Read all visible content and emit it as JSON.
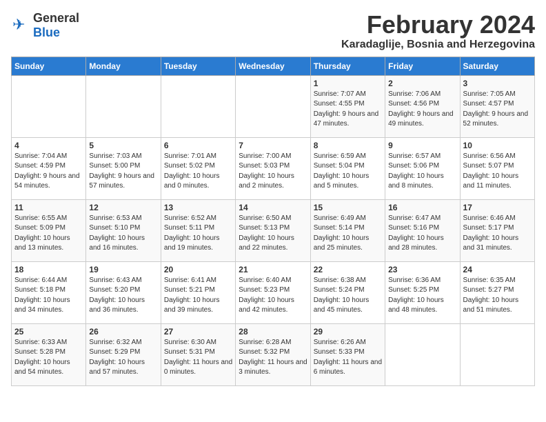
{
  "logo": {
    "general": "General",
    "blue": "Blue"
  },
  "title": "February 2024",
  "location": "Karadaglije, Bosnia and Herzegovina",
  "days_of_week": [
    "Sunday",
    "Monday",
    "Tuesday",
    "Wednesday",
    "Thursday",
    "Friday",
    "Saturday"
  ],
  "weeks": [
    [
      {
        "day": "",
        "info": ""
      },
      {
        "day": "",
        "info": ""
      },
      {
        "day": "",
        "info": ""
      },
      {
        "day": "",
        "info": ""
      },
      {
        "day": "1",
        "info": "Sunrise: 7:07 AM\nSunset: 4:55 PM\nDaylight: 9 hours and 47 minutes."
      },
      {
        "day": "2",
        "info": "Sunrise: 7:06 AM\nSunset: 4:56 PM\nDaylight: 9 hours and 49 minutes."
      },
      {
        "day": "3",
        "info": "Sunrise: 7:05 AM\nSunset: 4:57 PM\nDaylight: 9 hours and 52 minutes."
      }
    ],
    [
      {
        "day": "4",
        "info": "Sunrise: 7:04 AM\nSunset: 4:59 PM\nDaylight: 9 hours and 54 minutes."
      },
      {
        "day": "5",
        "info": "Sunrise: 7:03 AM\nSunset: 5:00 PM\nDaylight: 9 hours and 57 minutes."
      },
      {
        "day": "6",
        "info": "Sunrise: 7:01 AM\nSunset: 5:02 PM\nDaylight: 10 hours and 0 minutes."
      },
      {
        "day": "7",
        "info": "Sunrise: 7:00 AM\nSunset: 5:03 PM\nDaylight: 10 hours and 2 minutes."
      },
      {
        "day": "8",
        "info": "Sunrise: 6:59 AM\nSunset: 5:04 PM\nDaylight: 10 hours and 5 minutes."
      },
      {
        "day": "9",
        "info": "Sunrise: 6:57 AM\nSunset: 5:06 PM\nDaylight: 10 hours and 8 minutes."
      },
      {
        "day": "10",
        "info": "Sunrise: 6:56 AM\nSunset: 5:07 PM\nDaylight: 10 hours and 11 minutes."
      }
    ],
    [
      {
        "day": "11",
        "info": "Sunrise: 6:55 AM\nSunset: 5:09 PM\nDaylight: 10 hours and 13 minutes."
      },
      {
        "day": "12",
        "info": "Sunrise: 6:53 AM\nSunset: 5:10 PM\nDaylight: 10 hours and 16 minutes."
      },
      {
        "day": "13",
        "info": "Sunrise: 6:52 AM\nSunset: 5:11 PM\nDaylight: 10 hours and 19 minutes."
      },
      {
        "day": "14",
        "info": "Sunrise: 6:50 AM\nSunset: 5:13 PM\nDaylight: 10 hours and 22 minutes."
      },
      {
        "day": "15",
        "info": "Sunrise: 6:49 AM\nSunset: 5:14 PM\nDaylight: 10 hours and 25 minutes."
      },
      {
        "day": "16",
        "info": "Sunrise: 6:47 AM\nSunset: 5:16 PM\nDaylight: 10 hours and 28 minutes."
      },
      {
        "day": "17",
        "info": "Sunrise: 6:46 AM\nSunset: 5:17 PM\nDaylight: 10 hours and 31 minutes."
      }
    ],
    [
      {
        "day": "18",
        "info": "Sunrise: 6:44 AM\nSunset: 5:18 PM\nDaylight: 10 hours and 34 minutes."
      },
      {
        "day": "19",
        "info": "Sunrise: 6:43 AM\nSunset: 5:20 PM\nDaylight: 10 hours and 36 minutes."
      },
      {
        "day": "20",
        "info": "Sunrise: 6:41 AM\nSunset: 5:21 PM\nDaylight: 10 hours and 39 minutes."
      },
      {
        "day": "21",
        "info": "Sunrise: 6:40 AM\nSunset: 5:23 PM\nDaylight: 10 hours and 42 minutes."
      },
      {
        "day": "22",
        "info": "Sunrise: 6:38 AM\nSunset: 5:24 PM\nDaylight: 10 hours and 45 minutes."
      },
      {
        "day": "23",
        "info": "Sunrise: 6:36 AM\nSunset: 5:25 PM\nDaylight: 10 hours and 48 minutes."
      },
      {
        "day": "24",
        "info": "Sunrise: 6:35 AM\nSunset: 5:27 PM\nDaylight: 10 hours and 51 minutes."
      }
    ],
    [
      {
        "day": "25",
        "info": "Sunrise: 6:33 AM\nSunset: 5:28 PM\nDaylight: 10 hours and 54 minutes."
      },
      {
        "day": "26",
        "info": "Sunrise: 6:32 AM\nSunset: 5:29 PM\nDaylight: 10 hours and 57 minutes."
      },
      {
        "day": "27",
        "info": "Sunrise: 6:30 AM\nSunset: 5:31 PM\nDaylight: 11 hours and 0 minutes."
      },
      {
        "day": "28",
        "info": "Sunrise: 6:28 AM\nSunset: 5:32 PM\nDaylight: 11 hours and 3 minutes."
      },
      {
        "day": "29",
        "info": "Sunrise: 6:26 AM\nSunset: 5:33 PM\nDaylight: 11 hours and 6 minutes."
      },
      {
        "day": "",
        "info": ""
      },
      {
        "day": "",
        "info": ""
      }
    ]
  ]
}
